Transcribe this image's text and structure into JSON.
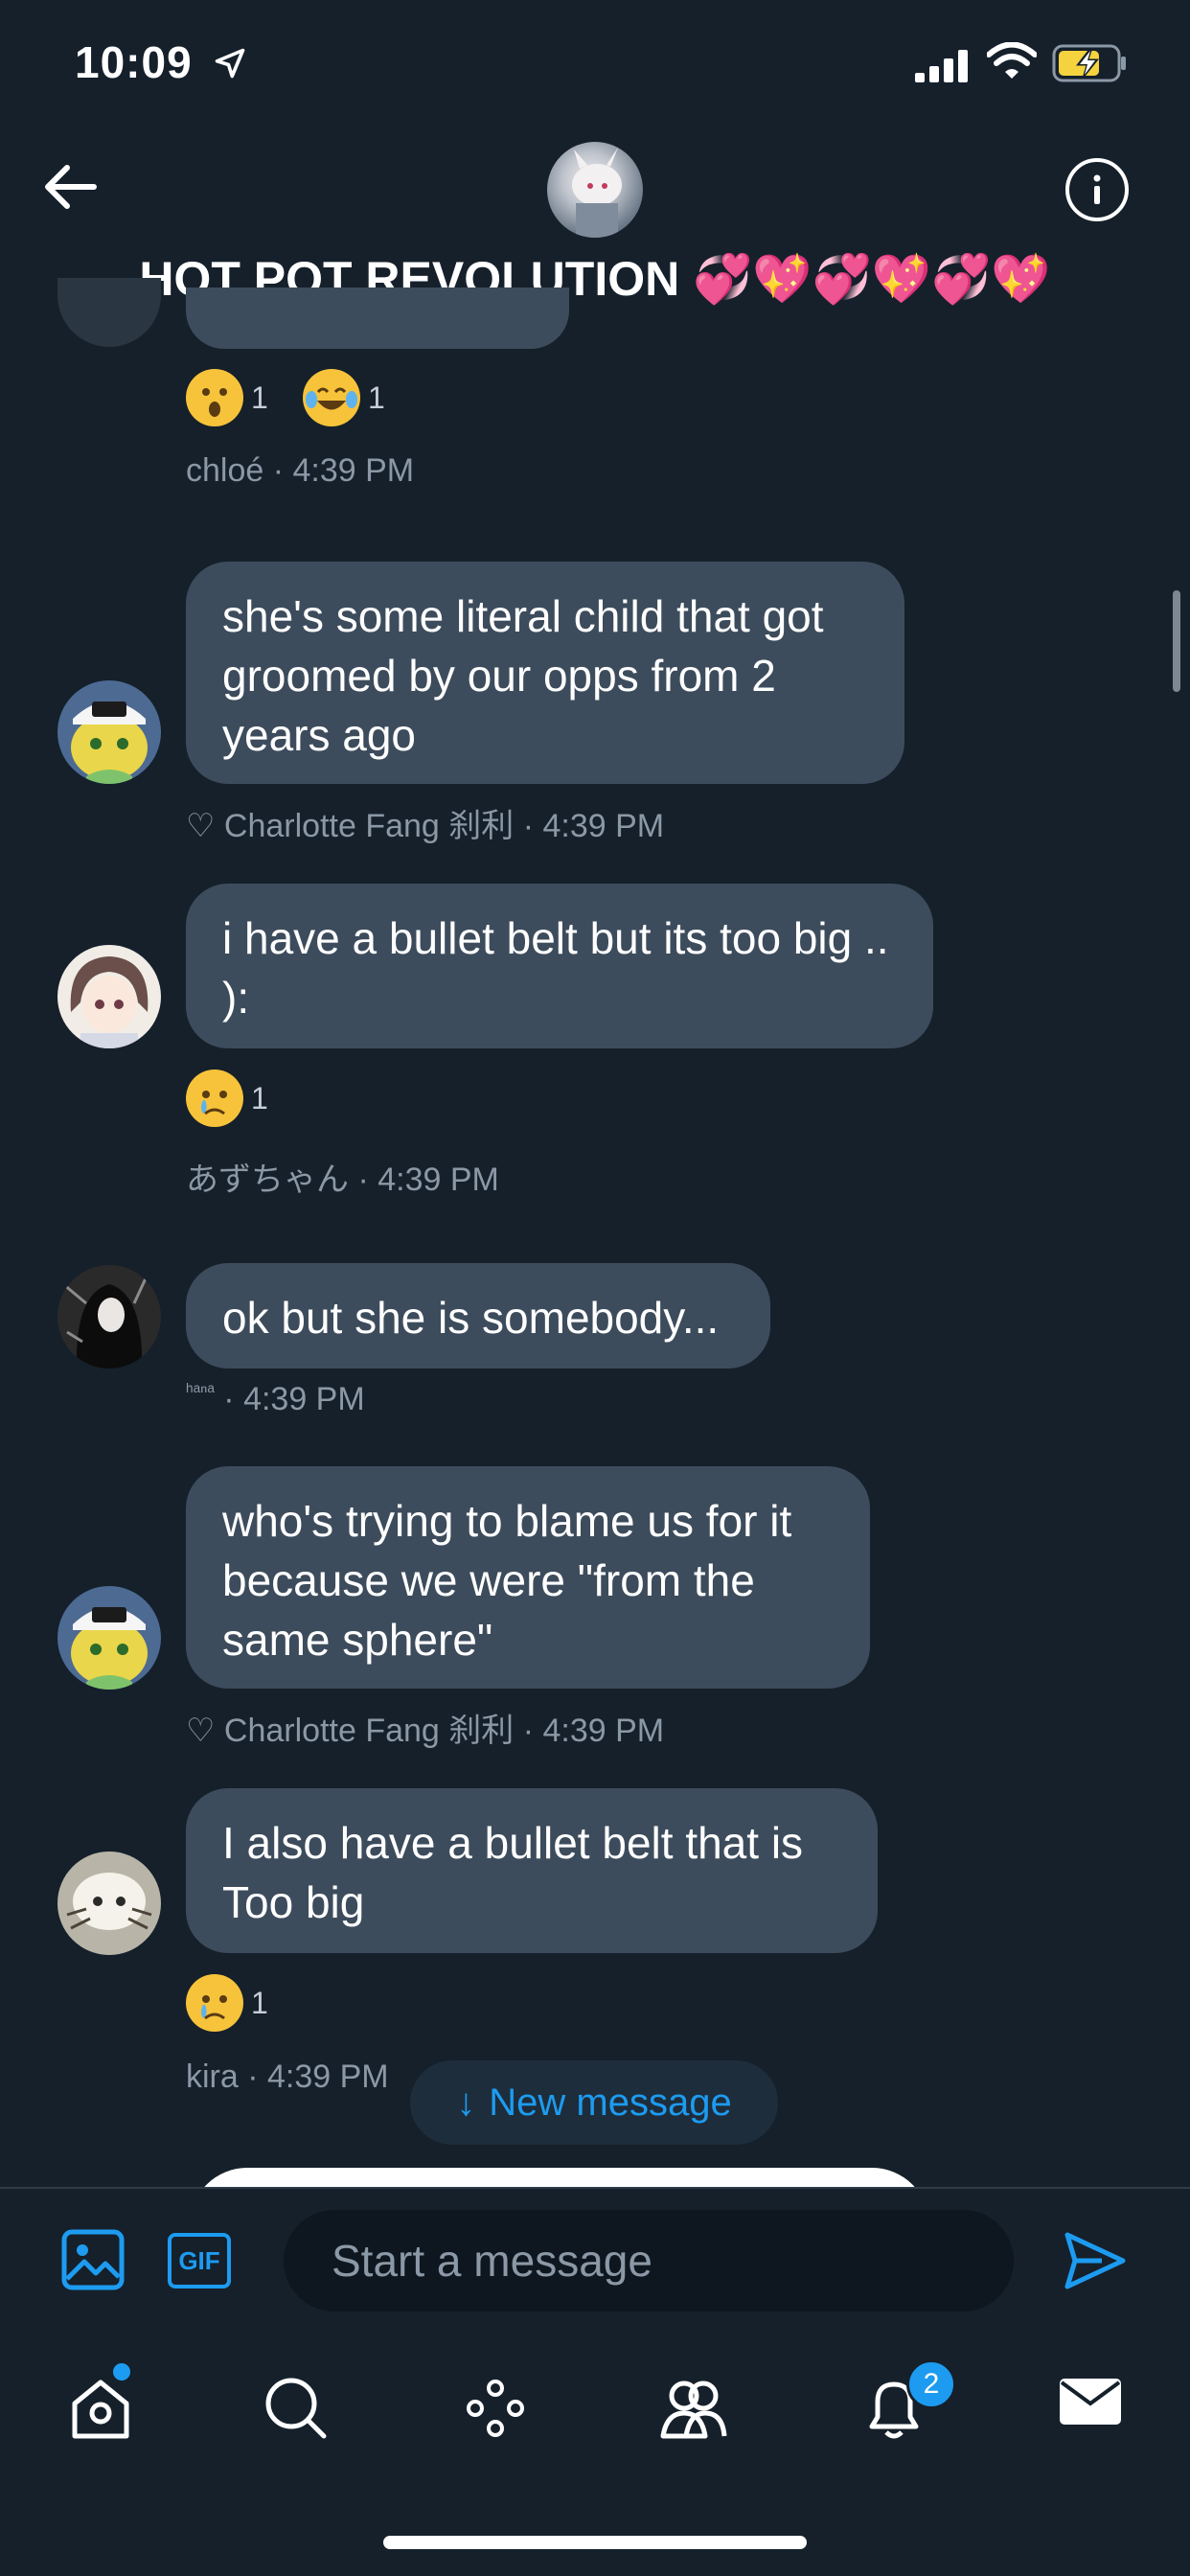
{
  "status_bar": {
    "time": "10:09"
  },
  "header": {
    "title": "HOT POT REVOLUTION 💞💖💞💖💞💖"
  },
  "messages": [
    {
      "reactions": [
        {
          "emoji": "😲",
          "count": "1"
        },
        {
          "emoji": "😂",
          "count": "1"
        }
      ],
      "meta": "chloé · 4:39 PM"
    },
    {
      "text": "she's some literal child that got groomed by our opps from 2 years ago",
      "meta": "♡ Charlotte Fang 刹利 · 4:39 PM"
    },
    {
      "text": "i have a bullet belt but its too big .. ):",
      "reactions": [
        {
          "emoji": "😢",
          "count": "1"
        }
      ],
      "meta": "あずちゃん · 4:39 PM"
    },
    {
      "text": "ok but she is somebody...",
      "meta_name": "ʰᵃⁿᵃ",
      "meta_time": "· 4:39 PM"
    },
    {
      "text": "who's trying to blame us for it because we were \"from the same sphere\"",
      "meta": "♡ Charlotte Fang 刹利 · 4:39 PM"
    },
    {
      "text": "I also have a bullet belt that is Too big",
      "reactions": [
        {
          "emoji": "😢",
          "count": "1"
        }
      ],
      "meta": "kira · 4:39 PM"
    }
  ],
  "new_message": {
    "arrow": "↓",
    "label": "New message"
  },
  "composer": {
    "placeholder": "Start a message",
    "gif_label": "GIF"
  },
  "nav": {
    "notifications_badge": "2"
  },
  "colors": {
    "accent": "#1d9bf0",
    "background": "#15202b",
    "bubble": "#3d4c5c",
    "muted": "#8b98a5"
  }
}
